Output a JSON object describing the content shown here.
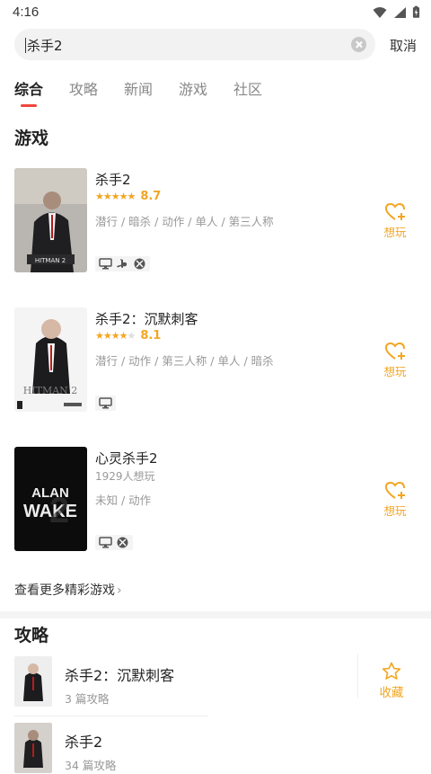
{
  "status": {
    "time": "4:16"
  },
  "search": {
    "value": "杀手2",
    "cancel_label": "取消"
  },
  "tabs": [
    {
      "label": "综合",
      "active": true
    },
    {
      "label": "攻略"
    },
    {
      "label": "新闻"
    },
    {
      "label": "游戏"
    },
    {
      "label": "社区"
    }
  ],
  "games_section": {
    "title": "游戏",
    "items": [
      {
        "title": "杀手2",
        "stars": "★★★★★",
        "score": "8.7",
        "tags": "潜行 / 暗杀 / 动作 / 单人 / 第三人称",
        "platforms": [
          "pc-icon",
          "playstation-icon",
          "xbox-icon"
        ],
        "want_label": "想玩",
        "cover_text": "HITMAN 2"
      },
      {
        "title": "杀手2：沉默刺客",
        "stars": "★★★★",
        "score": "8.1",
        "tags": "潜行 / 动作 / 第三人称 / 单人 / 暗杀",
        "platforms": [
          "pc-icon"
        ],
        "want_label": "想玩",
        "cover_text": "HITMAN 2"
      },
      {
        "title": "心灵杀手2",
        "sub": "1929人想玩",
        "tags": "未知 / 动作",
        "platforms": [
          "pc-icon",
          "xbox-icon"
        ],
        "want_label": "想玩",
        "cover_text_1": "ALAN",
        "cover_text_2": "WAKE"
      }
    ],
    "more_label": "查看更多精彩游戏"
  },
  "guides_section": {
    "title": "攻略",
    "items": [
      {
        "title": "杀手2：沉默刺客",
        "count": "3 篇攻略"
      },
      {
        "title": "杀手2",
        "count": "34 篇攻略"
      }
    ],
    "fav_label": "收藏"
  },
  "colors": {
    "accent": "#f2a623",
    "tab_indicator": "#f0463c"
  }
}
